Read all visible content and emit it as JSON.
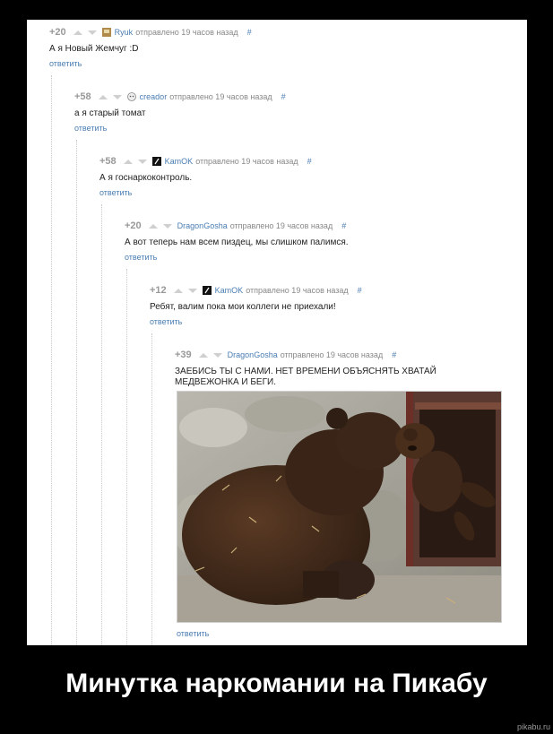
{
  "comments": [
    {
      "score": "+20",
      "author": "Ryuk",
      "time": "отправлено 19 часов назад",
      "hash": "#",
      "text": "А я Новый Жемчуг :D",
      "reply": "ответить"
    },
    {
      "score": "+58",
      "author": "creador",
      "time": "отправлено 19 часов назад",
      "hash": "#",
      "text": "а я старый томат",
      "reply": "ответить"
    },
    {
      "score": "+58",
      "author": "KamOK",
      "time": "отправлено 19 часов назад",
      "hash": "#",
      "text": "А я госнаркоконтроль.",
      "reply": "ответить"
    },
    {
      "score": "+20",
      "author": "DragonGosha",
      "time": "отправлено 19 часов назад",
      "hash": "#",
      "text": "А вот теперь нам всем пиздец, мы слишком палимся.",
      "reply": "ответить"
    },
    {
      "score": "+12",
      "author": "KamOK",
      "time": "отправлено 19 часов назад",
      "hash": "#",
      "text": "Ребят, валим пока мои коллеги не приехали!",
      "reply": "ответить"
    },
    {
      "score": "+39",
      "author": "DragonGosha",
      "time": "отправлено 19 часов назад",
      "hash": "#",
      "text": "ЗАЕБИСЬ ТЫ С НАМИ. НЕТ ВРЕМЕНИ ОБЪЯСНЯТЬ ХВАТАЙ МЕДВЕЖОНКА И БЕГИ.",
      "reply": "ответить"
    }
  ],
  "icons": {
    "upvote": "triangle-up",
    "downvote": "triangle-down"
  },
  "caption": "Минутка наркомании на Пикабу",
  "watermark": "pikabu.ru",
  "colors": {
    "background": "#000000",
    "panel": "#ffffff",
    "link": "#4a7db3",
    "score": "#999999"
  }
}
